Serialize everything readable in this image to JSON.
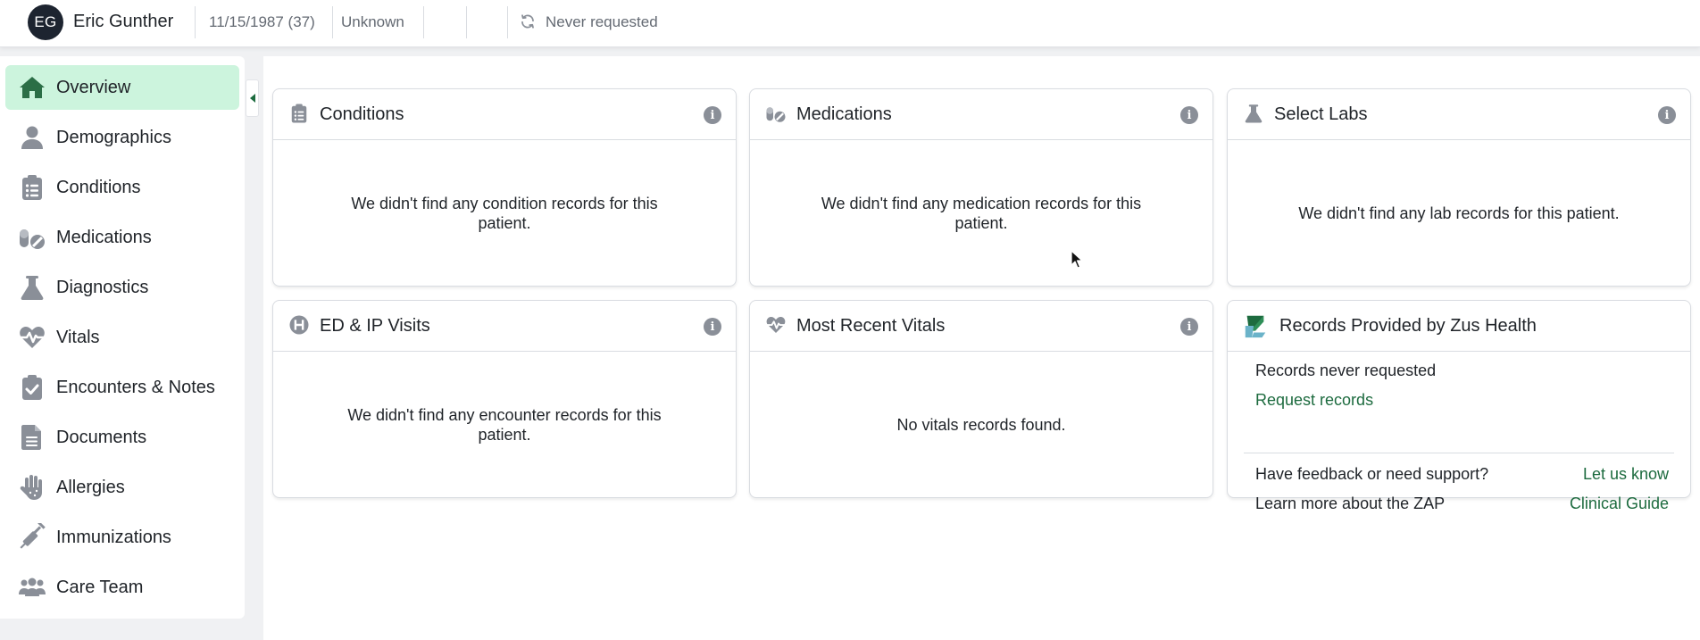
{
  "header": {
    "avatar_initials": "EG",
    "patient_name": "Eric Gunther",
    "dob": "11/15/1987 (37)",
    "sex": "Unknown",
    "records_status": "Never requested"
  },
  "sidebar": {
    "items": [
      {
        "label": "Overview",
        "icon": "home-icon",
        "active": true
      },
      {
        "label": "Demographics",
        "icon": "person-icon"
      },
      {
        "label": "Conditions",
        "icon": "clipboard-list-icon"
      },
      {
        "label": "Medications",
        "icon": "pills-icon"
      },
      {
        "label": "Diagnostics",
        "icon": "flask-icon"
      },
      {
        "label": "Vitals",
        "icon": "heartbeat-icon"
      },
      {
        "label": "Encounters & Notes",
        "icon": "clipboard-check-icon"
      },
      {
        "label": "Documents",
        "icon": "document-icon"
      },
      {
        "label": "Allergies",
        "icon": "hand-icon"
      },
      {
        "label": "Immunizations",
        "icon": "syringe-icon"
      },
      {
        "label": "Care Team",
        "icon": "people-icon"
      }
    ]
  },
  "cards": {
    "conditions": {
      "title": "Conditions",
      "message": "We didn't find any condition records for this patient."
    },
    "medications": {
      "title": "Medications",
      "message": "We didn't find any medication records for this patient."
    },
    "labs": {
      "title": "Select Labs",
      "message": "We didn't find any lab records for this patient."
    },
    "visits": {
      "title": "ED & IP Visits",
      "message": "We didn't find any encounter records for this patient."
    },
    "vitals": {
      "title": "Most Recent Vitals",
      "message": "No vitals records found."
    },
    "zus": {
      "title": "Records Provided by Zus Health",
      "status_text": "Records never requested",
      "request_link": "Request records",
      "feedback_text": "Have feedback or need support?",
      "feedback_link": "Let us know",
      "learn_text": "Learn more about the ZAP",
      "learn_link": "Clinical Guide"
    }
  },
  "colors": {
    "accent_green": "#1d6b3f",
    "active_nav_bg": "#ccf4dd",
    "icon_gray": "#8a8f98",
    "home_icon_green": "#2b6e46"
  }
}
